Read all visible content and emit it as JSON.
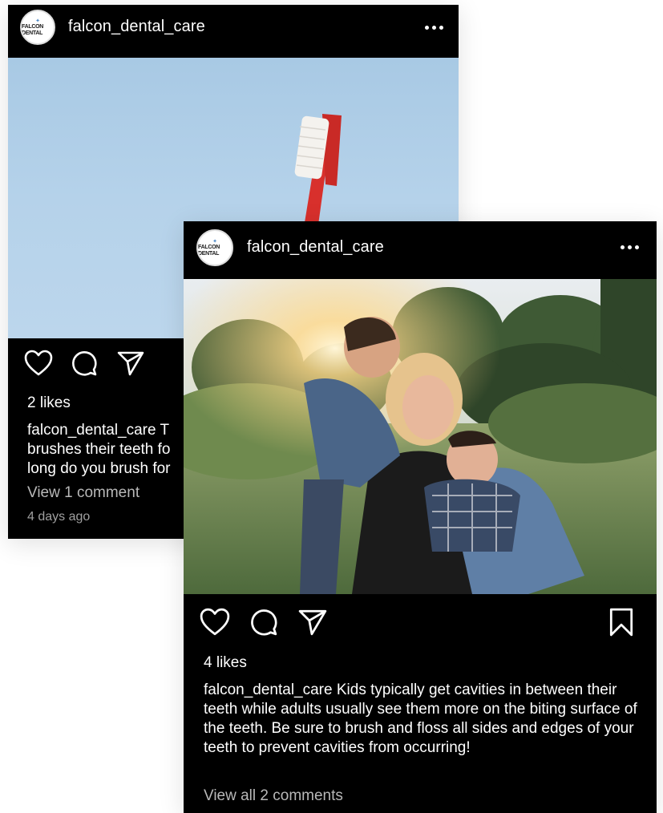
{
  "back_post": {
    "username": "falcon_dental_care",
    "avatar_logo": "FALCON DENTAL",
    "likes": "2 likes",
    "caption_user": "falcon_dental_care",
    "caption_lines": [
      "falcon_dental_care T",
      "brushes their teeth fo",
      "long do you brush for"
    ],
    "view_comments": "View 1 comment",
    "timestamp": "4 days ago",
    "photo_icon": "toothbrush-photo"
  },
  "front_post": {
    "username": "falcon_dental_care",
    "avatar_logo": "FALCON DENTAL",
    "likes": "4 likes",
    "caption_user": "falcon_dental_care",
    "caption_text": " Kids typically get cavities in between their teeth while adults usually see them more on the biting surface of the teeth. Be sure to brush and floss all sides and edges of your teeth to prevent cavities from occurring!",
    "view_comments": "View all 2 comments",
    "photo_icon": "family-photo"
  },
  "icons": {
    "like": "heart-icon",
    "comment": "comment-icon",
    "share": "send-icon",
    "save": "bookmark-icon",
    "more": "more-options-icon"
  },
  "colors": {
    "card_bg": "#000000",
    "text": "#ffffff",
    "muted": "#b8b8b8",
    "toothbrush_red": "#d8302c"
  }
}
